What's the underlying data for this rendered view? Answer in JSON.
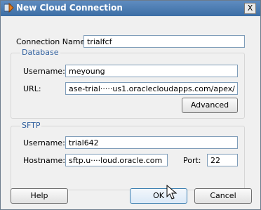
{
  "window": {
    "title": "New Cloud Connection",
    "close_label": "X"
  },
  "connection": {
    "label": "Connection Name:",
    "value": "trialfcf"
  },
  "database": {
    "title": "Database",
    "username_label": "Username:",
    "username_value": "meyoung",
    "url_label": "URL:",
    "url_value": "ase-trial·····us1.oraclecloudapps.com/apex/",
    "advanced_button": "Advanced"
  },
  "sftp": {
    "title": "SFTP",
    "username_label": "Username:",
    "username_value": "trial642",
    "hostname_label": "Hostname:",
    "hostname_value": "sftp.u····loud.oracle.com",
    "port_label": "Port:",
    "port_value": "22"
  },
  "buttons": {
    "help": "Help",
    "ok": "OK",
    "cancel": "Cancel"
  }
}
